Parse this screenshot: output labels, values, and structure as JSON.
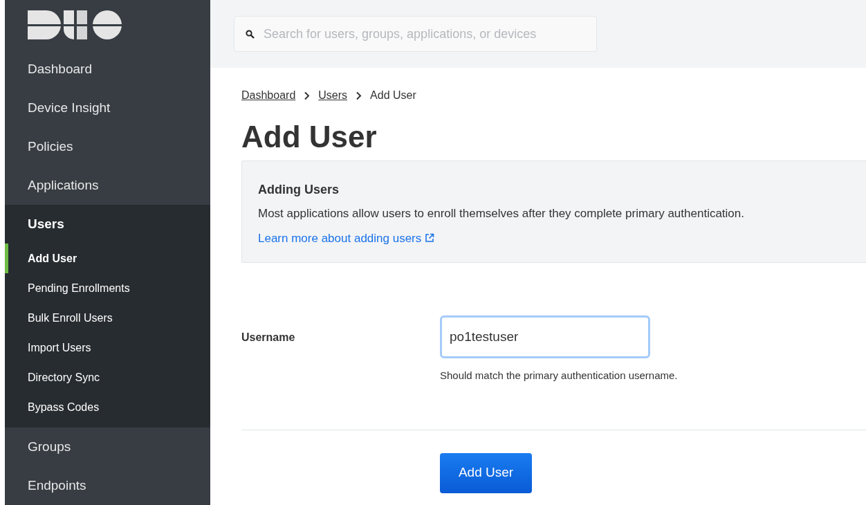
{
  "search": {
    "placeholder": "Search for users, groups, applications, or devices"
  },
  "sidebar": {
    "items": [
      {
        "label": "Dashboard",
        "expanded": false
      },
      {
        "label": "Device Insight",
        "expanded": false
      },
      {
        "label": "Policies",
        "expanded": false
      },
      {
        "label": "Applications",
        "expanded": false
      },
      {
        "label": "Users",
        "expanded": true,
        "children": [
          {
            "label": "Add User",
            "selected": true
          },
          {
            "label": "Pending Enrollments",
            "selected": false
          },
          {
            "label": "Bulk Enroll Users",
            "selected": false
          },
          {
            "label": "Import Users",
            "selected": false
          },
          {
            "label": "Directory Sync",
            "selected": false
          },
          {
            "label": "Bypass Codes",
            "selected": false
          }
        ]
      },
      {
        "label": "Groups",
        "expanded": false
      },
      {
        "label": "Endpoints",
        "expanded": false
      }
    ]
  },
  "breadcrumbs": [
    {
      "label": "Dashboard",
      "kind": "link"
    },
    {
      "label": "Users",
      "kind": "link"
    },
    {
      "label": "Add User",
      "kind": "current"
    }
  ],
  "page_title": "Add User",
  "info_box": {
    "title": "Adding Users",
    "text": "Most applications allow users to enroll themselves after they complete primary authentication.",
    "link": "Learn more about adding users"
  },
  "form": {
    "label": "Username",
    "value": "po1testuser",
    "hint": "Should match the primary authentication username."
  },
  "submit_button": "Add User"
}
